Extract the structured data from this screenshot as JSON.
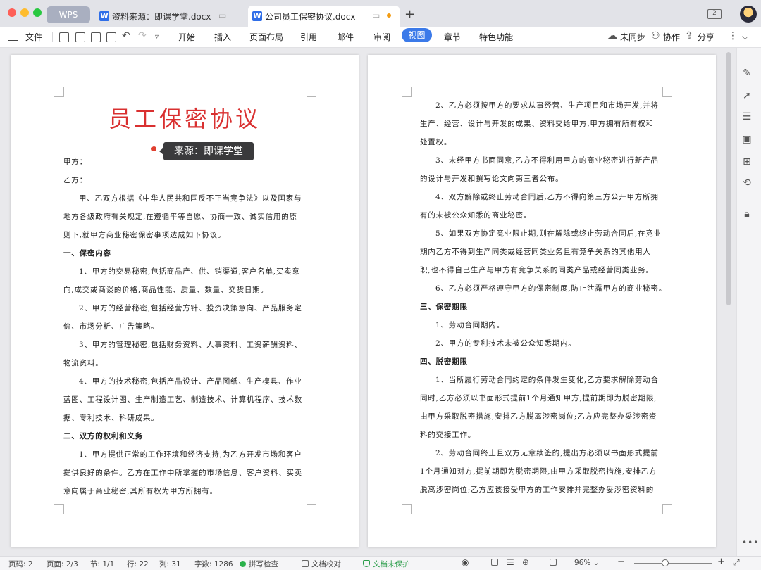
{
  "tabs": {
    "wps": "WPS",
    "doc1": "资料来源：即课学堂.docx",
    "doc2": "公司员工保密协议.docx",
    "doc_icon": "W"
  },
  "menubar": {
    "file": "文件",
    "items": [
      "开始",
      "插入",
      "页面布局",
      "引用",
      "邮件",
      "审阅",
      "视图",
      "章节",
      "特色功能"
    ],
    "active": "视图",
    "sync": "未同步",
    "collab": "协作",
    "share": "分享"
  },
  "tooltip": "来源：即课学堂",
  "left_page": {
    "title": "员工保密协议",
    "lines": [
      {
        "t": "甲方：",
        "h": false,
        "indent": false
      },
      {
        "t": "乙方：",
        "h": false,
        "indent": false
      },
      {
        "t": "甲、乙双方根据《中华人民共和国反不正当竞争法》以及国家与",
        "h": false,
        "indent": true
      },
      {
        "t": "地方各级政府有关规定,在遵循平等自愿、协商一致、诚实信用的原",
        "h": false,
        "indent": false
      },
      {
        "t": "则下,就甲方商业秘密保密事项达成如下协议。",
        "h": false,
        "indent": false
      },
      {
        "t": "一、保密内容",
        "h": true,
        "indent": false
      },
      {
        "t": "1、甲方的交易秘密,包括商品产、供、销渠道,客户名单,买卖意",
        "h": false,
        "indent": true
      },
      {
        "t": "向,成交或商谈的价格,商品性能、质量、数量、交货日期。",
        "h": false,
        "indent": false
      },
      {
        "t": "2、甲方的经营秘密,包括经营方针、投资决策意向、产品服务定",
        "h": false,
        "indent": true
      },
      {
        "t": "价、市场分析、广告策略。",
        "h": false,
        "indent": false
      },
      {
        "t": "3、甲方的管理秘密,包括财务资料、人事资料、工资薪酬资料、",
        "h": false,
        "indent": true
      },
      {
        "t": "物流资料。",
        "h": false,
        "indent": false
      },
      {
        "t": "4、甲方的技术秘密,包括产品设计、产品图纸、生产模具、作业",
        "h": false,
        "indent": true
      },
      {
        "t": "蓝图、工程设计图、生产制造工艺、制造技术、计算机程序、技术数",
        "h": false,
        "indent": false
      },
      {
        "t": "据、专利技术、科研成果。",
        "h": false,
        "indent": false
      },
      {
        "t": "二、双方的权利和义务",
        "h": true,
        "indent": false
      },
      {
        "t": "1、甲方提供正常的工作环境和经济支持,为乙方开发市场和客户",
        "h": false,
        "indent": true
      },
      {
        "t": "提供良好的条件。乙方在工作中所掌握的市场信息、客户资料、买卖",
        "h": false,
        "indent": false
      },
      {
        "t": "意向属于商业秘密,其所有权为甲方所拥有。",
        "h": false,
        "indent": false
      }
    ]
  },
  "right_page": {
    "lines": [
      {
        "t": "2、乙方必须按甲方的要求从事经营、生产项目和市场开发,并将",
        "h": false,
        "indent": true
      },
      {
        "t": "生产、经营、设计与开发的成果、资料交给甲方,甲方拥有所有权和",
        "h": false,
        "indent": false
      },
      {
        "t": "处置权。",
        "h": false,
        "indent": false
      },
      {
        "t": "3、未经甲方书面同意,乙方不得利用甲方的商业秘密进行新产品",
        "h": false,
        "indent": true
      },
      {
        "t": "的设计与开发和撰写论文向第三者公布。",
        "h": false,
        "indent": false
      },
      {
        "t": "4、双方解除或终止劳动合同后,乙方不得向第三方公开甲方所拥",
        "h": false,
        "indent": true
      },
      {
        "t": "有的未被公众知悉的商业秘密。",
        "h": false,
        "indent": false
      },
      {
        "t": "5、如果双方协定竞业限止期,则在解除或终止劳动合同后,在竞业",
        "h": false,
        "indent": true
      },
      {
        "t": "期内乙方不得到生产同类或经营同类业务且有竞争关系的其他用人",
        "h": false,
        "indent": false
      },
      {
        "t": "职,也不得自己生产与甲方有竞争关系的同类产品或经营同类业务。",
        "h": false,
        "indent": false
      },
      {
        "t": "6、乙方必须严格遵守甲方的保密制度,防止泄露甲方的商业秘密。",
        "h": false,
        "indent": true
      },
      {
        "t": "三、保密期限",
        "h": true,
        "indent": false
      },
      {
        "t": "1、劳动合同期内。",
        "h": false,
        "indent": true
      },
      {
        "t": "2、甲方的专利技术未被公众知悉期内。",
        "h": false,
        "indent": true
      },
      {
        "t": "四、脱密期限",
        "h": true,
        "indent": false
      },
      {
        "t": "1、当所履行劳动合同约定的条件发生变化,乙方要求解除劳动合",
        "h": false,
        "indent": true
      },
      {
        "t": "同时,乙方必须以书面形式提前1个月通知甲方,提前期即为脱密期限,",
        "h": false,
        "indent": false
      },
      {
        "t": "由甲方采取脱密措施,安排乙方脱离涉密岗位;乙方应完整办妥涉密资",
        "h": false,
        "indent": false
      },
      {
        "t": "料的交接工作。",
        "h": false,
        "indent": false
      },
      {
        "t": "2、劳动合同终止且双方无意续签的,提出方必须以书面形式提前",
        "h": false,
        "indent": true
      },
      {
        "t": "1个月通知对方,提前期即为脱密期限,由甲方采取脱密措施,安排乙方",
        "h": false,
        "indent": false
      },
      {
        "t": "脱离涉密岗位;乙方应该接受甲方的工作安排并完整办妥涉密资料的",
        "h": false,
        "indent": false
      }
    ]
  },
  "status": {
    "page_num": "页码: 2",
    "page_of": "页面: 2/3",
    "section": "节: 1/1",
    "row": "行: 22",
    "col": "列: 31",
    "word_count": "字数: 1286",
    "spell": "拼写检查",
    "proof": "文档校对",
    "protect": "文档未保护",
    "zoom": "96%",
    "zoom_level": 0.4
  },
  "colors": {
    "accent": "#3b7ae9",
    "title_red": "#d93030",
    "protect_green": "#2bb24c"
  }
}
